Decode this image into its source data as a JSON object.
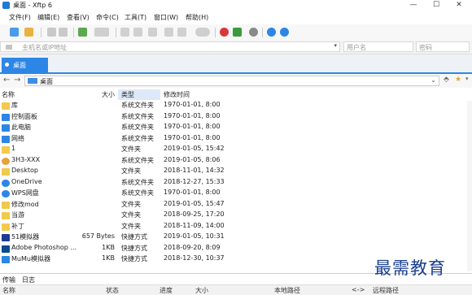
{
  "window": {
    "title": "桌面 - Xftp 6",
    "controls": [
      "—",
      "☐",
      "✕"
    ]
  },
  "menu": [
    "文件(F)",
    "编辑(E)",
    "查看(V)",
    "命令(C)",
    "工具(T)",
    "窗口(W)",
    "帮助(H)"
  ],
  "address": {
    "host_placeholder": "主机名或IP地址",
    "user_placeholder": "用户名",
    "password_placeholder": "密码"
  },
  "tab": {
    "label": "桌面"
  },
  "path": {
    "value": "桌面"
  },
  "columns": {
    "name": "名称",
    "size": "大小",
    "type": "类型",
    "modified": "修改时间"
  },
  "files": [
    {
      "name": "库",
      "size": "",
      "type": "系统文件夹",
      "modified": "1970-01-01, 8:00",
      "icon": "folder-icon",
      "color": "#f2c94c"
    },
    {
      "name": "控制面板",
      "size": "",
      "type": "系统文件夹",
      "modified": "1970-01-01, 8:00",
      "icon": "control-panel-icon",
      "color": "#2d86e5"
    },
    {
      "name": "此电脑",
      "size": "",
      "type": "系统文件夹",
      "modified": "1970-01-01, 8:00",
      "icon": "computer-icon",
      "color": "#2d86e5"
    },
    {
      "name": "网络",
      "size": "",
      "type": "系统文件夹",
      "modified": "1970-01-01, 8:00",
      "icon": "network-icon",
      "color": "#2d86e5"
    },
    {
      "name": "1",
      "size": "",
      "type": "文件夹",
      "modified": "2019-01-05, 15:42",
      "icon": "folder-icon",
      "color": "#f2c94c"
    },
    {
      "name": "3H3-XXX",
      "size": "",
      "type": "系统文件夹",
      "modified": "2019-01-05, 8:06",
      "icon": "user-icon",
      "color": "#e6a23c"
    },
    {
      "name": "Desktop",
      "size": "",
      "type": "文件夹",
      "modified": "2018-11-01, 14:32",
      "icon": "folder-icon",
      "color": "#f2c94c"
    },
    {
      "name": "OneDrive",
      "size": "",
      "type": "系统文件夹",
      "modified": "2018-12-27, 15:33",
      "icon": "cloud-icon",
      "color": "#2d86e5"
    },
    {
      "name": "WPS网盘",
      "size": "",
      "type": "系统文件夹",
      "modified": "1970-01-01, 8:00",
      "icon": "cloud-icon",
      "color": "#2d86e5"
    },
    {
      "name": "修改mod",
      "size": "",
      "type": "文件夹",
      "modified": "2019-01-05, 15:47",
      "icon": "folder-icon",
      "color": "#f2c94c"
    },
    {
      "name": "当游",
      "size": "",
      "type": "文件夹",
      "modified": "2018-09-25, 17:20",
      "icon": "folder-icon",
      "color": "#f2c94c"
    },
    {
      "name": "补丁",
      "size": "",
      "type": "文件夹",
      "modified": "2018-11-09, 14:00",
      "icon": "folder-icon",
      "color": "#f2c94c"
    },
    {
      "name": "51模拟器",
      "size": "657 Bytes",
      "type": "快捷方式",
      "modified": "2019-01-05, 10:31",
      "icon": "app-shortcut-icon",
      "color": "#1f3a93"
    },
    {
      "name": "Adobe Photoshop ...",
      "size": "1KB",
      "type": "快捷方式",
      "modified": "2018-09-20, 8:09",
      "icon": "app-shortcut-icon",
      "color": "#0b4a8f"
    },
    {
      "name": "MuMu模拟器",
      "size": "1KB",
      "type": "快捷方式",
      "modified": "2018-12-30, 10:37",
      "icon": "app-shortcut-icon",
      "color": "#2d86e5"
    }
  ],
  "bottom_tabs": [
    "传输",
    "日志"
  ],
  "transfer_columns": [
    "名称",
    "状态",
    "进度",
    "大小",
    "本地路径",
    "<->",
    "远程路径"
  ],
  "watermark": "最需教育"
}
